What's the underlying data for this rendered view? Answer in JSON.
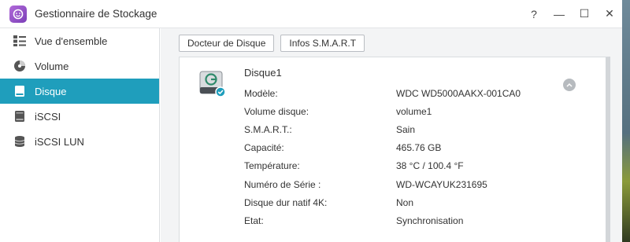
{
  "window": {
    "title": "Gestionnaire de Stockage",
    "controls": [
      "?",
      "—",
      "☐",
      "✕"
    ]
  },
  "sidebar": {
    "items": [
      {
        "label": "Vue d'ensemble",
        "icon": "overview-icon",
        "active": false
      },
      {
        "label": "Volume",
        "icon": "volume-icon",
        "active": false
      },
      {
        "label": "Disque",
        "icon": "disk-icon",
        "active": true
      },
      {
        "label": "iSCSI",
        "icon": "iscsi-icon",
        "active": false
      },
      {
        "label": "iSCSI LUN",
        "icon": "iscsi-lun-icon",
        "active": false
      }
    ]
  },
  "toolbar": {
    "doctor_label": "Docteur de Disque",
    "smart_label": "Infos S.M.A.R.T"
  },
  "disk": {
    "name": "Disque1",
    "details": [
      {
        "label": "Modèle:",
        "value": "WDC WD5000AAKX-001CA0"
      },
      {
        "label": "Volume disque:",
        "value": "volume1"
      },
      {
        "label": "S.M.A.R.T.:",
        "value": "Sain"
      },
      {
        "label": "Capacité:",
        "value": "465.76 GB"
      },
      {
        "label": "Température:",
        "value": "38 °C / 100.4 °F"
      },
      {
        "label": "Numéro de Série :",
        "value": "WD-WCAYUK231695"
      },
      {
        "label": "Disque dur natif 4K:",
        "value": "Non"
      },
      {
        "label": "Etat:",
        "value": "Synchronisation"
      }
    ]
  },
  "colors": {
    "accent": "#1f9ebc",
    "app_icon": "#9b55cc"
  }
}
